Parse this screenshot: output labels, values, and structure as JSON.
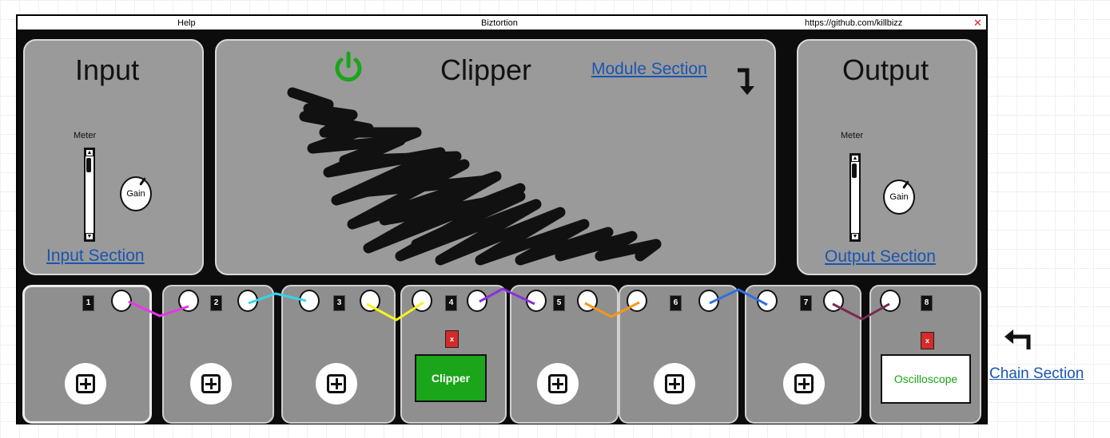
{
  "window": {
    "help": "Help",
    "title": "Biztortion",
    "url": "https://github.com/killbizz",
    "close": "✕"
  },
  "input": {
    "title": "Input",
    "meter_label": "Meter",
    "gain_label": "Gain",
    "section_link": "Input Section"
  },
  "module": {
    "title": "Clipper",
    "power_icon": "power-icon",
    "power_color": "#1aa51a",
    "section_link": "Module Section"
  },
  "output": {
    "title": "Output",
    "meter_label": "Meter",
    "gain_label": "Gain",
    "section_link": "Output Section"
  },
  "chain": {
    "section_link": "Chain Section",
    "slots": [
      {
        "number": "1",
        "module": ""
      },
      {
        "number": "2",
        "module": ""
      },
      {
        "number": "3",
        "module": ""
      },
      {
        "number": "4",
        "module": "Clipper",
        "remove": "x"
      },
      {
        "number": "5",
        "module": ""
      },
      {
        "number": "6",
        "module": ""
      },
      {
        "number": "7",
        "module": ""
      },
      {
        "number": "8",
        "module": "Oscilloscope",
        "remove": "x"
      }
    ],
    "cable_colors": [
      "#e636e6",
      "#2fd8e8",
      "#f5f51a",
      "#8a2fe0",
      "#f5961a",
      "#2f6fe0",
      "#7a2a50"
    ]
  }
}
